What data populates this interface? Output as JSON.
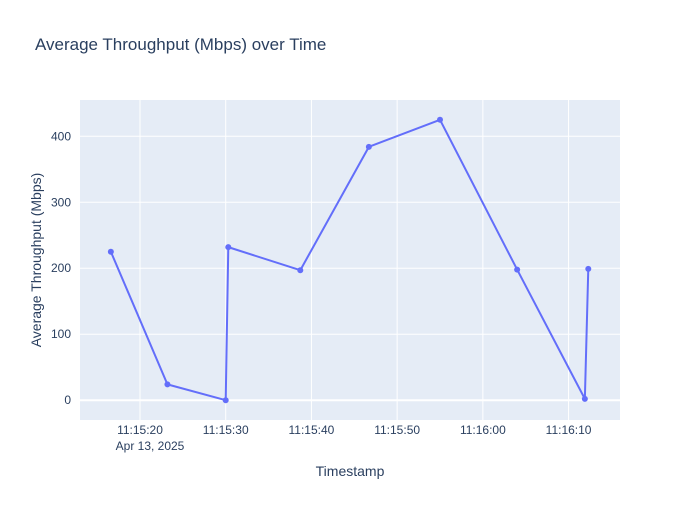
{
  "chart_data": {
    "type": "line",
    "title": "Average Throughput (Mbps) over Time",
    "xlabel": "Timestamp",
    "ylabel": "Average Throughput (Mbps)",
    "x_axis": {
      "kind": "time",
      "range": [
        "2025-04-13 11:15:13",
        "2025-04-13 11:16:16"
      ],
      "tick_labels": [
        "11:15:20",
        "11:15:30",
        "11:15:40",
        "11:15:50",
        "11:16:00",
        "11:16:10"
      ],
      "tick_values": [
        "2025-04-13 11:15:20",
        "2025-04-13 11:15:30",
        "2025-04-13 11:15:40",
        "2025-04-13 11:15:50",
        "2025-04-13 11:16:00",
        "2025-04-13 11:16:10"
      ],
      "date_label": "Apr 13, 2025"
    },
    "y_axis": {
      "range": [
        -30,
        455
      ],
      "tick_values": [
        0,
        100,
        200,
        300,
        400
      ],
      "tick_labels": [
        "0",
        "100",
        "200",
        "300",
        "400"
      ]
    },
    "grid": true,
    "colors": {
      "plot_bg": "#e5ecf6",
      "grid": "#ffffff",
      "series": "#636efa",
      "text": "#2a3f5f"
    },
    "series": [
      {
        "x": [
          "2025-04-13 11:15:16.6",
          "2025-04-13 11:15:23.2",
          "2025-04-13 11:15:30.0",
          "2025-04-13 11:15:30.3",
          "2025-04-13 11:15:38.7",
          "2025-04-13 11:15:46.7",
          "2025-04-13 11:15:55.0",
          "2025-04-13 11:16:04.0",
          "2025-04-13 11:16:11.9",
          "2025-04-13 11:16:12.3"
        ],
        "y": [
          225,
          24,
          0,
          232,
          197,
          384,
          425,
          198,
          2,
          199
        ]
      }
    ]
  }
}
